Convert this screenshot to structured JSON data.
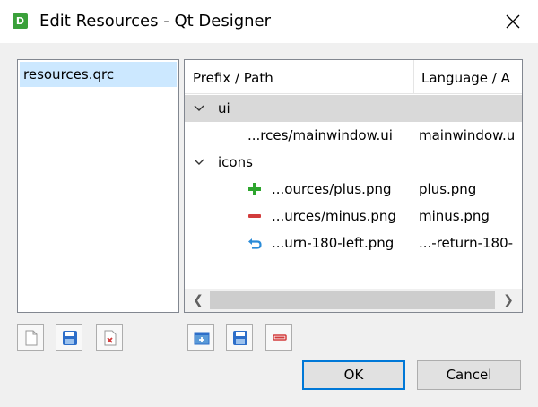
{
  "window": {
    "title": "Edit Resources - Qt Designer",
    "app_icon_letter": "D",
    "close_icon": "close-icon"
  },
  "file_list": {
    "items": [
      {
        "label": "resources.qrc",
        "selected": true
      }
    ]
  },
  "tree": {
    "columns": [
      "Prefix / Path",
      "Language / A"
    ],
    "rows": [
      {
        "kind": "prefix",
        "label": "ui",
        "expanded": true,
        "selected": true,
        "alias": ""
      },
      {
        "kind": "file",
        "label": "...rces/mainwindow.ui",
        "alias": "mainwindow.u",
        "icon": "none"
      },
      {
        "kind": "prefix",
        "label": "icons",
        "expanded": true,
        "selected": false,
        "alias": ""
      },
      {
        "kind": "file",
        "label": "...ources/plus.png",
        "alias": "plus.png",
        "icon": "plus-icon"
      },
      {
        "kind": "file",
        "label": "...urces/minus.png",
        "alias": "minus.png",
        "icon": "minus-icon"
      },
      {
        "kind": "file",
        "label": "...urn-180-left.png",
        "alias": "...-return-180-",
        "icon": "arrow-return-left-icon"
      }
    ]
  },
  "left_toolbar": {
    "buttons": [
      "new-file-icon",
      "save-icon",
      "remove-file-icon"
    ]
  },
  "right_toolbar": {
    "buttons": [
      "add-prefix-icon",
      "save-icon",
      "remove-icon"
    ]
  },
  "buttons": {
    "ok": "OK",
    "cancel": "Cancel"
  },
  "colors": {
    "selection": "#cce8ff",
    "accent": "#0078d7",
    "plus_green": "#2ea52e",
    "minus_red": "#d23c3c",
    "arrow_blue": "#2a8bd8"
  }
}
